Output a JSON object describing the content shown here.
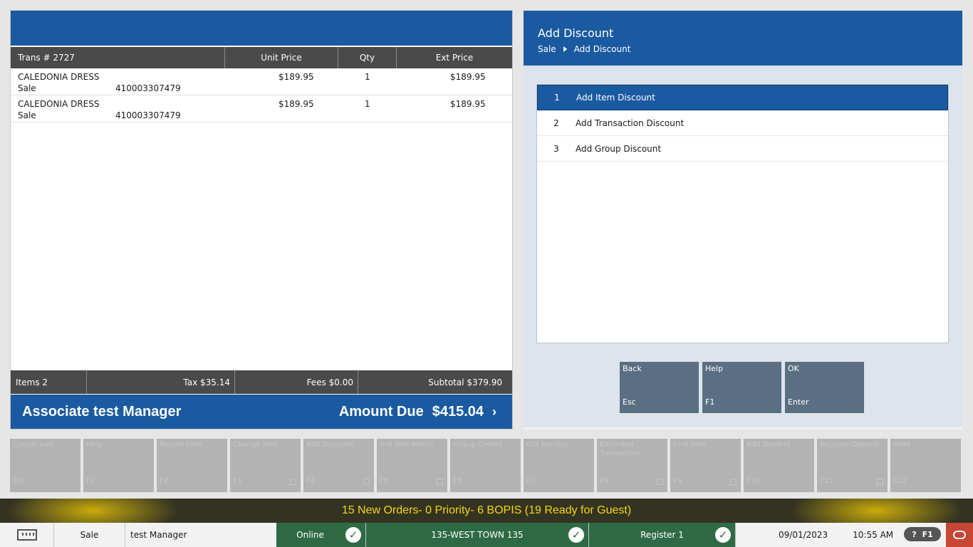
{
  "transaction": {
    "trans_label": "Trans #  2727",
    "col_unit_price": "Unit Price",
    "col_qty": "Qty",
    "col_ext_price": "Ext Price",
    "items": [
      {
        "name": "CALEDONIA DRESS",
        "type": "Sale",
        "sku": "410003307479",
        "unit_price": "$189.95",
        "qty": "1",
        "ext_price": "$189.95"
      },
      {
        "name": "CALEDONIA DRESS",
        "type": "Sale",
        "sku": "410003307479",
        "unit_price": "$189.95",
        "qty": "1",
        "ext_price": "$189.95"
      }
    ],
    "totals": {
      "items": "Items 2",
      "tax": "Tax $35.14",
      "fees": "Fees $0.00",
      "subtotal": "Subtotal $379.90"
    },
    "associate": "Associate test Manager",
    "amount_due_label": "Amount Due",
    "amount_due_value": "$415.04",
    "amount_due_chevron": "›"
  },
  "discount": {
    "title": "Add Discount",
    "breadcrumb": [
      "Sale",
      "Add Discount"
    ],
    "options": [
      {
        "num": "1",
        "label": "Add Item Discount",
        "selected": true
      },
      {
        "num": "2",
        "label": "Add Transaction Discount",
        "selected": false
      },
      {
        "num": "3",
        "label": "Add Group Discount",
        "selected": false
      }
    ],
    "buttons": [
      {
        "label": "Back",
        "key": "Esc"
      },
      {
        "label": "Help",
        "key": "F1"
      },
      {
        "label": "OK",
        "key": "Enter"
      }
    ]
  },
  "function_keys": [
    {
      "label": "Cancel Sale",
      "key": "Esc",
      "lock": false
    },
    {
      "label": "Help",
      "key": "F1",
      "lock": false
    },
    {
      "label": "Return Item",
      "key": "F2",
      "lock": false
    },
    {
      "label": "Change Item",
      "key": "F3",
      "lock": true
    },
    {
      "label": "Add Discount",
      "key": "F4",
      "lock": true
    },
    {
      "label": "Sell Non-Merch",
      "key": "F5",
      "lock": true
    },
    {
      "label": "Pickup Orders",
      "key": "F6",
      "lock": false
    },
    {
      "label": "Gift Receipt",
      "key": "F7",
      "lock": false
    },
    {
      "label": "Extended Transaction",
      "key": "F8",
      "lock": true
    },
    {
      "label": "Find Item",
      "key": "F9",
      "lock": true
    },
    {
      "label": "Add Tenders",
      "key": "F10",
      "lock": false
    },
    {
      "label": "Register Options",
      "key": "F11",
      "lock": true
    },
    {
      "label": "More...",
      "key": "F12",
      "lock": false
    }
  ],
  "notice": "15 New Orders- 0 Priority- 6 BOPIS (19 Ready for Guest)",
  "status": {
    "keyboard_icon": "keyboard-icon",
    "mode": "Sale",
    "user": "test Manager",
    "online": "Online",
    "store": "135-WEST TOWN 135",
    "register": "Register 1",
    "check_glyph": "✓",
    "date": "09/01/2023",
    "time": "10:55 AM",
    "help_q": "?",
    "help_key": "F1",
    "colors": {
      "primary": "#1a5aa0",
      "status_green": "#2e6b44",
      "oracle_red": "#c74634",
      "notice_text": "#f2d80e"
    }
  }
}
